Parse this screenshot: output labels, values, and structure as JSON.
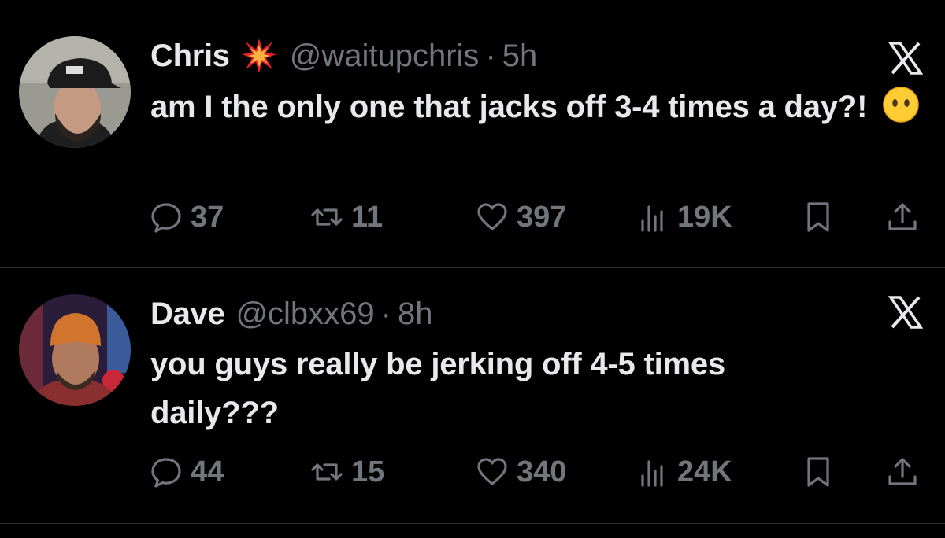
{
  "tweets": [
    {
      "name": "Chris",
      "handle": "@waitupchris",
      "separator": "·",
      "time": "5h",
      "text": "am I the only one that jacks off 3-4 times a day?!",
      "replies": "37",
      "retweets": "11",
      "likes": "397",
      "views": "19K",
      "icons": [
        "collision-emoji",
        "face-without-mouth-emoji",
        "x-logo-icon",
        "reply-icon",
        "retweet-icon",
        "like-icon",
        "views-icon",
        "bookmark-icon",
        "share-icon"
      ]
    },
    {
      "name": "Dave",
      "handle": "@clbxx69",
      "separator": "·",
      "time": "8h",
      "text": "you guys really be jerking off 4-5 times daily???",
      "replies": "44",
      "retweets": "15",
      "likes": "340",
      "views": "24K",
      "icons": [
        "x-logo-icon",
        "reply-icon",
        "retweet-icon",
        "like-icon",
        "views-icon",
        "bookmark-icon",
        "share-icon"
      ]
    }
  ],
  "colors": {
    "background": "#000000",
    "text": "#e7e9ea",
    "secondary": "#71767b",
    "divider": "#2f3336"
  }
}
